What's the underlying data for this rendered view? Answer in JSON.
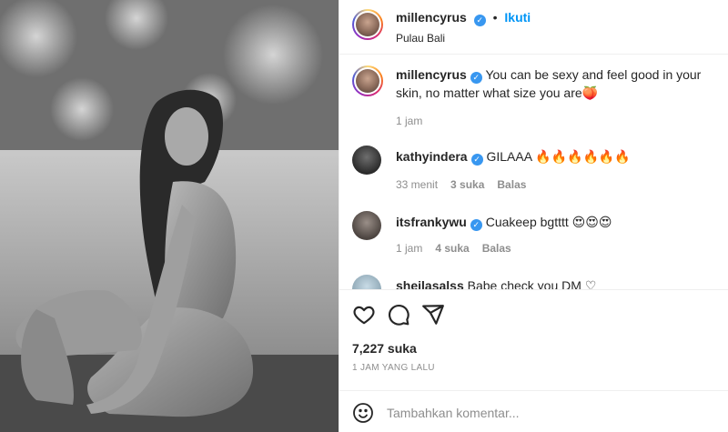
{
  "post": {
    "author": "millencyrus",
    "follow_label": "Ikuti",
    "location": "Pulau Bali",
    "caption": "You can be sexy and feel good in your skin, no matter what size you are",
    "caption_emoji": "🍑",
    "caption_time": "1 jam"
  },
  "comments": [
    {
      "user": "kathyindera",
      "verified": true,
      "text": "GILAAA",
      "emoji": "🔥🔥🔥🔥🔥🔥",
      "time": "33 menit",
      "likes": "3 suka",
      "reply": "Balas"
    },
    {
      "user": "itsfrankywu",
      "verified": true,
      "text": "Cuakeep bgtttt",
      "emoji": "😍😍😍",
      "time": "1 jam",
      "likes": "4 suka",
      "reply": "Balas"
    },
    {
      "user": "sheilasalss",
      "verified": false,
      "text": "Babe check you DM",
      "emoji": "♡"
    }
  ],
  "stats": {
    "likes": "7,227 suka",
    "posted": "1 JAM YANG LALU"
  },
  "composer": {
    "placeholder": "Tambahkan komentar..."
  },
  "icons": {
    "verified": "verified-badge-icon",
    "like": "heart-icon",
    "comment": "comment-icon",
    "share": "share-icon",
    "emoji": "smiley-icon"
  },
  "colors": {
    "accent": "#0095f6",
    "verified": "#3897f0",
    "text": "#262626",
    "muted": "#8e8e8e"
  }
}
